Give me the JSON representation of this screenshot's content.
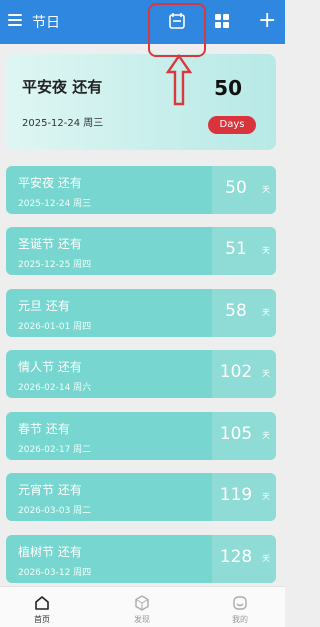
{
  "header": {
    "title": "节日",
    "icons": [
      "menu-icon",
      "calendar-icon",
      "grid-icon",
      "plus-icon"
    ]
  },
  "hero": {
    "title": "平安夜 还有",
    "date": "2025-12-24 周三",
    "days": "50",
    "badge": "Days"
  },
  "items": [
    {
      "name": "平安夜 还有",
      "date": "2025-12-24 周三",
      "days": "50",
      "unit": "天"
    },
    {
      "name": "圣诞节 还有",
      "date": "2025-12-25 周四",
      "days": "51",
      "unit": "天"
    },
    {
      "name": "元旦 还有",
      "date": "2026-01-01 周四",
      "days": "58",
      "unit": "天"
    },
    {
      "name": "情人节 还有",
      "date": "2026-02-14 周六",
      "days": "102",
      "unit": "天"
    },
    {
      "name": "春节 还有",
      "date": "2026-02-17 周二",
      "days": "105",
      "unit": "天"
    },
    {
      "name": "元宵节 还有",
      "date": "2026-03-03 周二",
      "days": "119",
      "unit": "天"
    },
    {
      "name": "植树节 还有",
      "date": "2026-03-12 周四",
      "days": "128",
      "unit": "天"
    }
  ],
  "tabs": [
    {
      "label": "首页",
      "icon": "home-icon"
    },
    {
      "label": "发现",
      "icon": "discover-icon"
    },
    {
      "label": "我的",
      "icon": "profile-icon"
    }
  ],
  "colors": {
    "header": "#2f87e0",
    "card": "#77d6cf",
    "badge": "#d9343c",
    "annotation": "#d9393c"
  }
}
